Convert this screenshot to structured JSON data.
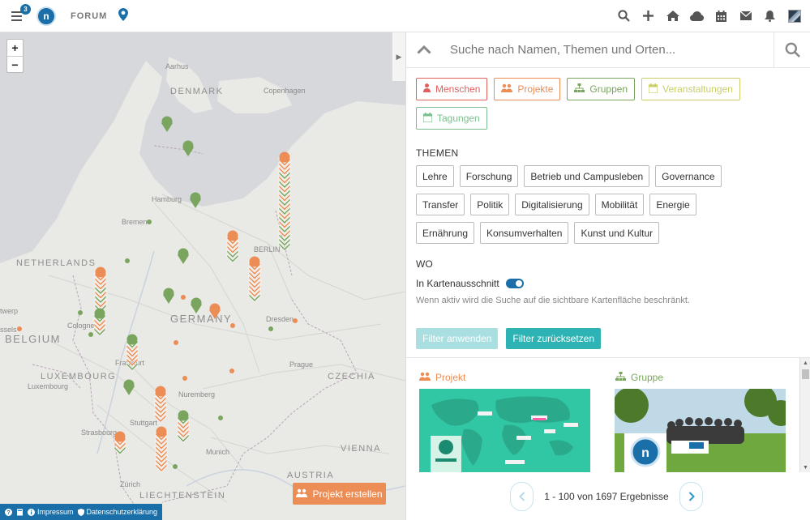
{
  "topbar": {
    "notification_count": "3",
    "logo_letter": "n",
    "forum_label": "FORUM",
    "icons": [
      "search-icon",
      "plus-icon",
      "home-icon",
      "cloud-icon",
      "calendar-icon",
      "mail-icon",
      "bell-icon",
      "avatar"
    ]
  },
  "map": {
    "zoom_in": "+",
    "zoom_out": "−",
    "labels": {
      "denmark": "DENMARK",
      "netherlands": "NETHERLANDS",
      "belgium": "BELGIUM",
      "luxembourg_country": "LUXEMBOURG",
      "germany": "GERMANY",
      "czechia": "CZECHIA",
      "austria": "AUSTRIA",
      "liechtenstein": "LIECHTENSTEIN",
      "aarhus": "Aarhus",
      "copenhagen": "Copenhagen",
      "hamburg": "Hamburg",
      "bremen": "Bremen",
      "berlin": "BERLIN",
      "dresden": "Dresden",
      "cologne": "Cologne",
      "frankfurt": "Frankfurt",
      "prague": "Prague",
      "luxembourg_city": "Luxembourg",
      "nuremberg": "Nuremberg",
      "stuttgart": "Stuttgart",
      "strasbourg": "Strasbourg",
      "munich": "Munich",
      "vienna": "VIENNA",
      "zurich": "Zürich",
      "werp": "twerp",
      "ssels": "ssels"
    },
    "create_project_label": "Projekt erstellen",
    "footer": {
      "impressum": "Impressum",
      "datenschutz": "Datenschutzerklärung"
    }
  },
  "panel": {
    "search_placeholder": "Suche nach Namen, Themen und Orten...",
    "types": [
      {
        "label": "Menschen",
        "color": "#e0605e"
      },
      {
        "label": "Projekte",
        "color": "#ec8d55"
      },
      {
        "label": "Gruppen",
        "color": "#7aa55f"
      },
      {
        "label": "Veranstaltungen",
        "color": "#c8cf6a"
      },
      {
        "label": "Tagungen",
        "color": "#7cbf8e"
      }
    ],
    "themen_title": "THEMEN",
    "topics": [
      "Lehre",
      "Forschung",
      "Betrieb und Campusleben",
      "Governance",
      "Transfer",
      "Politik",
      "Digitalisierung",
      "Mobilität",
      "Energie",
      "Ernährung",
      "Konsumverhalten",
      "Kunst und Kultur"
    ],
    "wo_title": "WO",
    "toggle_label": "In Kartenausschnitt",
    "toggle_hint": "Wenn aktiv wird die Suche auf die sichtbare Kartenfläche beschränkt.",
    "apply_filter": "Filter anwenden",
    "reset_filter": "Filter zurücksetzen",
    "results": {
      "card1_type": "Projekt",
      "card2_type": "Gruppe",
      "pagination_text": "1 - 100 von 1697 Ergebnisse"
    }
  },
  "colors": {
    "brand_blue": "#1a6fa8",
    "teal": "#2db3b3",
    "teal_light": "#a9dfe0",
    "orange": "#ec8d55",
    "green": "#7aa55f"
  }
}
